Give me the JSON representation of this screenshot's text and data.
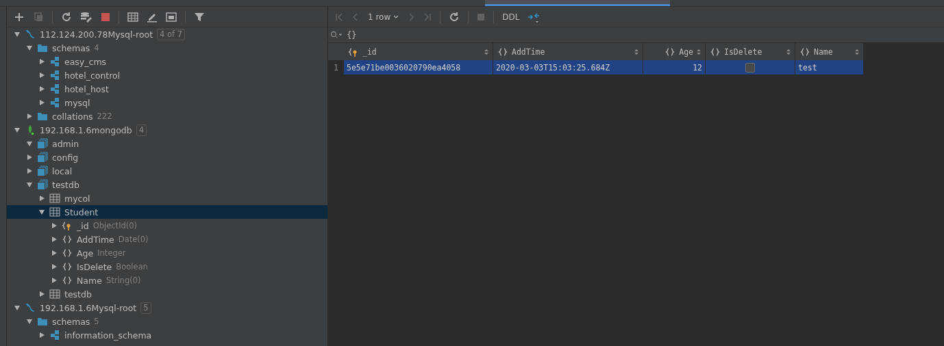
{
  "sidebar": {
    "tree": [
      {
        "label": "112.124.200.78Mysql-root",
        "kind": "mysql",
        "expanded": true,
        "selected": false,
        "badge": "4 of 7",
        "children": [
          {
            "label": "schemas",
            "kind": "folder",
            "expanded": true,
            "selected": false,
            "count": "4",
            "children": [
              {
                "label": "easy_cms",
                "kind": "schema",
                "expanded": false,
                "selected": false
              },
              {
                "label": "hotel_control",
                "kind": "schema",
                "expanded": false,
                "selected": false
              },
              {
                "label": "hotel_host",
                "kind": "schema",
                "expanded": false,
                "selected": false
              },
              {
                "label": "mysql",
                "kind": "schema",
                "expanded": false,
                "selected": false
              }
            ]
          },
          {
            "label": "collations",
            "kind": "folder",
            "expanded": false,
            "selected": false,
            "count": "222"
          }
        ]
      },
      {
        "label": "192.168.1.6mongodb",
        "kind": "mongo",
        "expanded": true,
        "selected": false,
        "badge": "4",
        "children": [
          {
            "label": "admin",
            "kind": "db",
            "expanded": true,
            "selected": false
          },
          {
            "label": "config",
            "kind": "db",
            "expanded": false,
            "selected": false
          },
          {
            "label": "local",
            "kind": "db",
            "expanded": false,
            "selected": false
          },
          {
            "label": "testdb",
            "kind": "db",
            "expanded": true,
            "selected": false,
            "children": [
              {
                "label": "mycol",
                "kind": "table",
                "expanded": false,
                "selected": false
              },
              {
                "label": "Student",
                "kind": "table",
                "expanded": true,
                "selected": true,
                "children": [
                  {
                    "label": "_id",
                    "kind": "key",
                    "expanded": false,
                    "selected": false,
                    "count": "ObjectId(0)"
                  },
                  {
                    "label": "AddTime",
                    "kind": "field",
                    "expanded": false,
                    "selected": false,
                    "count": "Date(0)"
                  },
                  {
                    "label": "Age",
                    "kind": "field",
                    "expanded": false,
                    "selected": false,
                    "count": "Integer"
                  },
                  {
                    "label": "IsDelete",
                    "kind": "field",
                    "expanded": false,
                    "selected": false,
                    "count": "Boolean"
                  },
                  {
                    "label": "Name",
                    "kind": "field",
                    "expanded": false,
                    "selected": false,
                    "count": "String(0)"
                  }
                ]
              },
              {
                "label": "testdb",
                "kind": "table",
                "expanded": false,
                "selected": false
              }
            ]
          }
        ]
      },
      {
        "label": "192.168.1.6Mysql-root",
        "kind": "mysql",
        "expanded": true,
        "selected": false,
        "badge": "5",
        "children": [
          {
            "label": "schemas",
            "kind": "folder",
            "expanded": true,
            "selected": false,
            "count": "5",
            "children": [
              {
                "label": "information_schema",
                "kind": "schema",
                "expanded": false,
                "selected": false
              }
            ]
          }
        ]
      }
    ]
  },
  "result": {
    "rows_dropdown": "1 row",
    "ddl": "DDL",
    "filter": {
      "value": "{}"
    },
    "columns": [
      {
        "name": "_id",
        "kind": "key"
      },
      {
        "name": "AddTime",
        "kind": "field"
      },
      {
        "name": "Age",
        "kind": "field"
      },
      {
        "name": "IsDelete",
        "kind": "field"
      },
      {
        "name": "Name",
        "kind": "field"
      }
    ],
    "rows": [
      {
        "number": "1",
        "selected": true,
        "cells": [
          {
            "kind": "text",
            "value": "5e5e71be0036020790ea4058"
          },
          {
            "kind": "text",
            "value": "2020-03-03T15:03:25.684Z"
          },
          {
            "kind": "number",
            "value": "12"
          },
          {
            "kind": "checkbox",
            "checked": false
          },
          {
            "kind": "text",
            "value": "test"
          }
        ]
      }
    ]
  }
}
